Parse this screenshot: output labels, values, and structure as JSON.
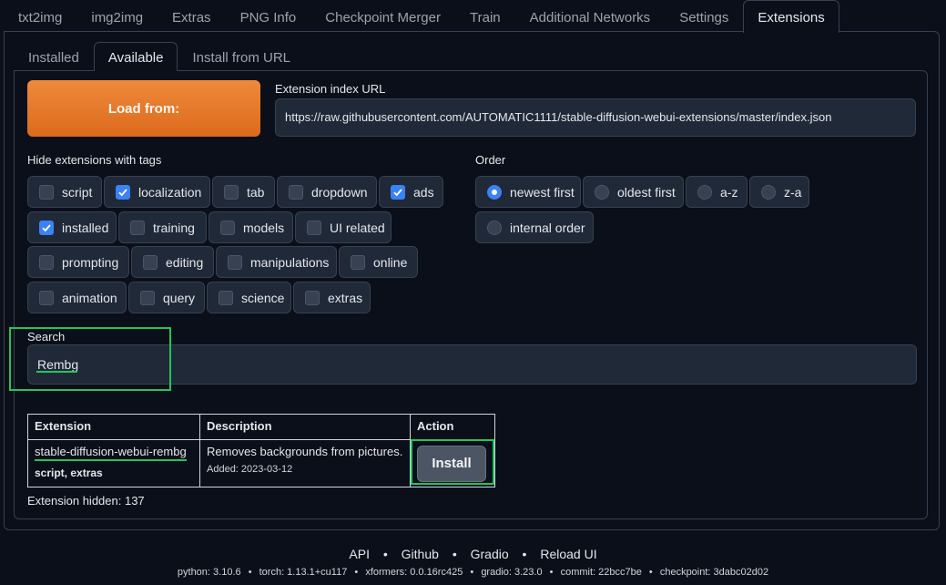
{
  "top_tabs": [
    "txt2img",
    "img2img",
    "Extras",
    "PNG Info",
    "Checkpoint Merger",
    "Train",
    "Additional Networks",
    "Settings",
    "Extensions"
  ],
  "sub_tabs": [
    "Installed",
    "Available",
    "Install from URL"
  ],
  "load_button": "Load from:",
  "index_url": {
    "label": "Extension index URL",
    "value": "https://raw.githubusercontent.com/AUTOMATIC1111/stable-diffusion-webui-extensions/master/index.json"
  },
  "hide_tags": {
    "label": "Hide extensions with tags",
    "options": [
      {
        "label": "script",
        "checked": false
      },
      {
        "label": "localization",
        "checked": true
      },
      {
        "label": "tab",
        "checked": false
      },
      {
        "label": "dropdown",
        "checked": false
      },
      {
        "label": "ads",
        "checked": true
      },
      {
        "label": "installed",
        "checked": true
      },
      {
        "label": "training",
        "checked": false
      },
      {
        "label": "models",
        "checked": false
      },
      {
        "label": "UI related",
        "checked": false
      },
      {
        "label": "prompting",
        "checked": false
      },
      {
        "label": "editing",
        "checked": false
      },
      {
        "label": "manipulations",
        "checked": false
      },
      {
        "label": "online",
        "checked": false
      },
      {
        "label": "animation",
        "checked": false
      },
      {
        "label": "query",
        "checked": false
      },
      {
        "label": "science",
        "checked": false
      },
      {
        "label": "extras",
        "checked": false
      }
    ]
  },
  "order": {
    "label": "Order",
    "selected": "newest first",
    "options": [
      "newest first",
      "oldest first",
      "a-z",
      "z-a",
      "internal order"
    ]
  },
  "search": {
    "label": "Search",
    "value": "Rembg"
  },
  "table": {
    "headers": [
      "Extension",
      "Description",
      "Action"
    ],
    "rows": [
      {
        "name": "stable-diffusion-webui-rembg",
        "tags": "script, extras",
        "description": "Removes backgrounds from pictures.",
        "added": "Added: 2023-03-12",
        "action": "Install"
      }
    ]
  },
  "hidden_count": "Extension hidden: 137",
  "footer": {
    "links": [
      "API",
      "Github",
      "Gradio",
      "Reload UI"
    ],
    "separator": "•",
    "versions": [
      "python: 3.10.6",
      "torch: 1.13.1+cu117",
      "xformers: 0.0.16rc425",
      "gradio: 3.23.0",
      "commit: 22bcc7be",
      "checkpoint: 3dabc02d02"
    ]
  },
  "colors": {
    "background": "#0b0f19",
    "accent_orange": "#e67528",
    "checkbox_blue": "#3b82f6",
    "highlight_green": "#22c55e"
  },
  "icons": {
    "checked": "check-icon",
    "radio_selected": "radio-dot-icon"
  }
}
